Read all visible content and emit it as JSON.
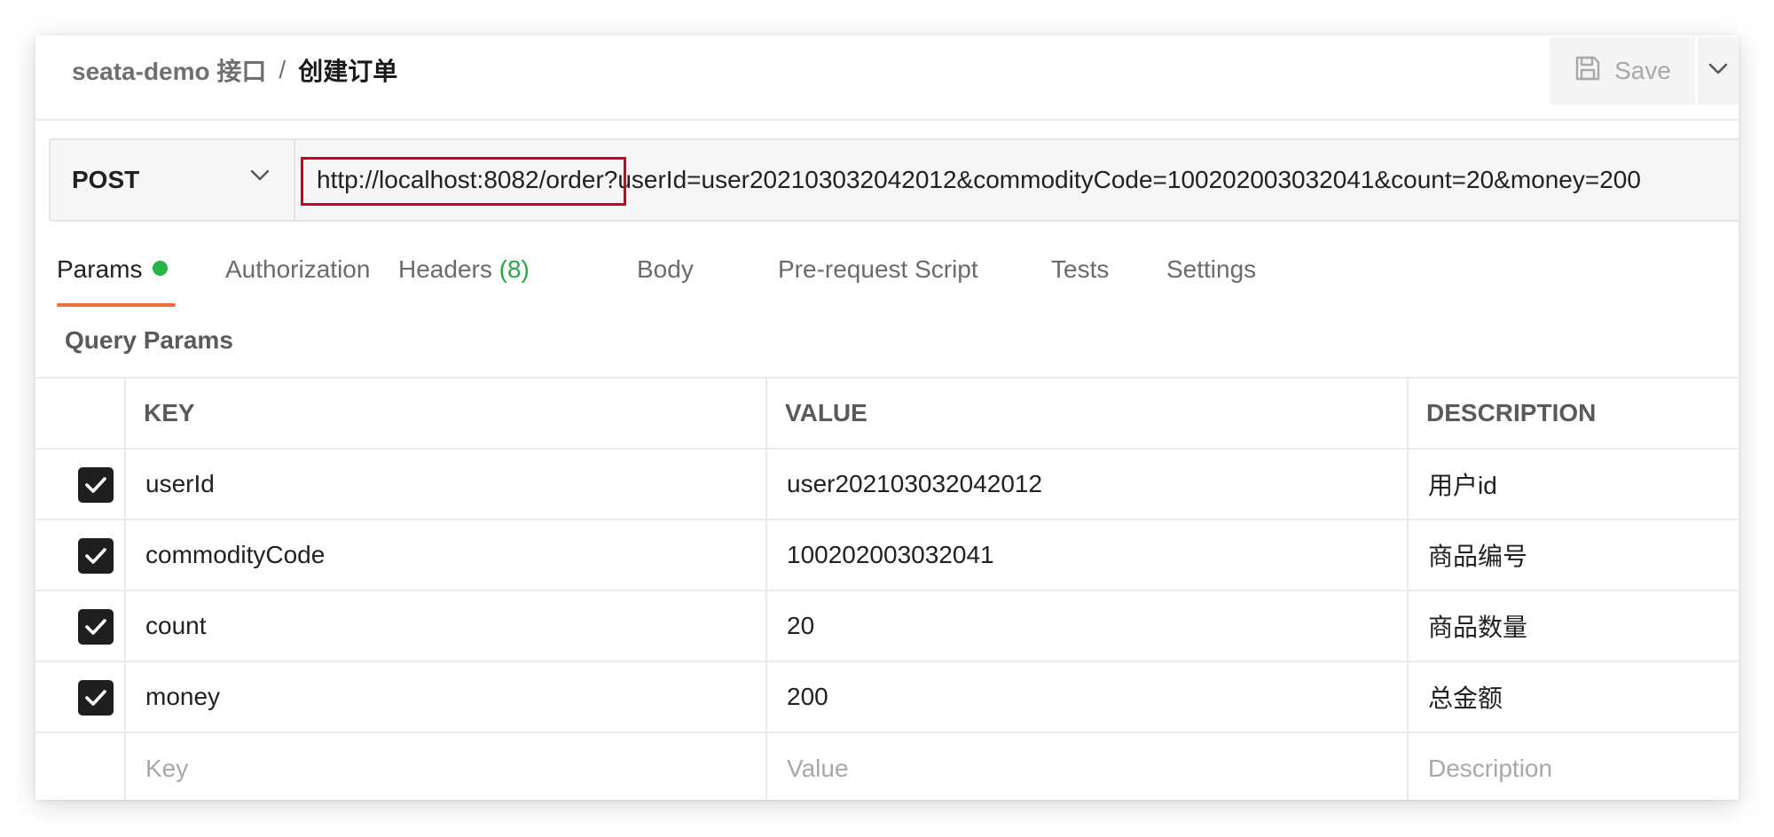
{
  "header": {
    "breadcrumb_parent": "seata-demo 接口",
    "breadcrumb_separator": "/",
    "breadcrumb_current": "创建订单",
    "save_label": "Save",
    "save_icon": "floppy-disk-icon",
    "dropdown_icon": "chevron-down-icon"
  },
  "request": {
    "method": "POST",
    "url": "http://localhost:8082/order?userId=user202103032042012&commodityCode=100202003032041&count=20&money=200",
    "highlight_color": "#d0021b"
  },
  "tabs": [
    {
      "label": "Params",
      "active": true
    },
    {
      "label": "Authorization"
    },
    {
      "label": "Headers",
      "count": "(8)"
    },
    {
      "label": "Body"
    },
    {
      "label": "Pre-request Script"
    },
    {
      "label": "Tests"
    },
    {
      "label": "Settings"
    }
  ],
  "colors": {
    "accent": "#f26b3a",
    "params_indicator": "#26b547",
    "headers_count": "#26a84a"
  },
  "query_params": {
    "title": "Query Params",
    "columns": [
      "KEY",
      "VALUE",
      "DESCRIPTION"
    ],
    "rows": [
      {
        "checked": true,
        "key": "userId",
        "value": "user202103032042012",
        "description": "用户id"
      },
      {
        "checked": true,
        "key": "commodityCode",
        "value": "100202003032041",
        "description": "商品编号"
      },
      {
        "checked": true,
        "key": "count",
        "value": "20",
        "description": "商品数量"
      },
      {
        "checked": true,
        "key": "money",
        "value": "200",
        "description": "总金额"
      }
    ],
    "placeholders": {
      "key": "Key",
      "value": "Value",
      "description": "Description"
    }
  }
}
